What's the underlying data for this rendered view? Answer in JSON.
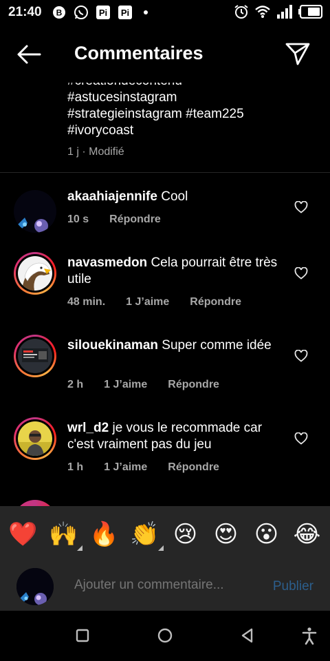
{
  "status_bar": {
    "time": "21:40",
    "icons": [
      "b-icon",
      "whatsapp-icon",
      "pi-icon",
      "pi-icon",
      "dot-icon"
    ],
    "right_icons": [
      "alarm-icon",
      "wifi-icon",
      "signal-icon",
      "battery-icon"
    ]
  },
  "header": {
    "title": "Commentaires"
  },
  "caption": {
    "text": "#creationdecontenu\n#astucesinstagram\n#strategieinstagram #team225\n#ivorycoast",
    "lines": [
      "#creationdecontenu",
      "#astucesinstagram",
      "#strategieinstagram #team225",
      "#ivorycoast"
    ],
    "meta": "1 j · Modifié"
  },
  "comments": [
    {
      "username": "akaahiajennife",
      "text": "Cool",
      "time": "10 s",
      "likes": "",
      "reply": "Répondre"
    },
    {
      "username": "navasmedon",
      "text": "Cela pourrait être très utile",
      "time": "48 min.",
      "likes": "1 J’aime",
      "reply": "Répondre"
    },
    {
      "username": "silouekinaman",
      "text": "Super comme idée",
      "time": "2 h",
      "likes": "1 J’aime",
      "reply": "Répondre"
    },
    {
      "username": "wrl_d2",
      "text": "je vous le recommade car c'est vraiment pas du jeu",
      "time": "1 h",
      "likes": "1 J’aime",
      "reply": "Répondre"
    }
  ],
  "emoji_bar": {
    "emojis": [
      "❤️",
      "🙌",
      "🔥",
      "👏",
      "😢",
      "😍",
      "😮",
      "😂"
    ]
  },
  "input": {
    "placeholder": "Ajouter un commentaire...",
    "publish_label": "Publier"
  },
  "colors": {
    "background": "#000000",
    "secondary_text": "#a8a8a8",
    "publish_disabled": "#2c5e8c",
    "bar_background": "#262626"
  }
}
